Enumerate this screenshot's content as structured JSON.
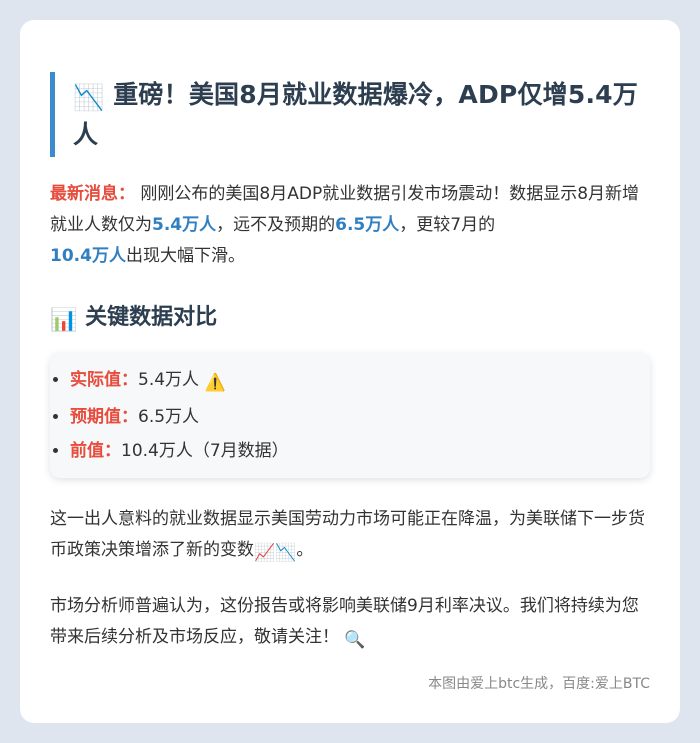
{
  "article": {
    "title": {
      "icon": "chart-decreasing-icon",
      "icon_glyph": "📉",
      "text": "重磅！美国8月就业数据爆冷，ADP仅增5.4万人"
    },
    "intro": {
      "label": "最新消息：",
      "t1": "刚刚公布的美国8月ADP就业数据引发市场震动！数据显示8月新增就业人数仅为",
      "actual": "5.4万人",
      "t2": "，远不及预期的",
      "expected": "6.5万人",
      "t3": "，更较7月的",
      "previous": "10.4万人",
      "t4": "出现大幅下滑。"
    },
    "section": {
      "icon": "bar-chart-icon",
      "icon_glyph": "📊",
      "text": "关键数据对比"
    },
    "comparison": [
      {
        "key": "实际值：",
        "value": "5.4万人",
        "icon": "warning-icon",
        "icon_glyph": "⚠️"
      },
      {
        "key": "预期值：",
        "value": "6.5万人"
      },
      {
        "key": "前值：",
        "value": "10.4万人（7月数据）"
      }
    ],
    "para2": {
      "text": "这一出人意料的就业数据显示美国劳动力市场可能正在降温，为美联储下一步货币政策决策增添了新的变数",
      "icon1": "chart-increasing-icon",
      "glyph1": "📈",
      "icon2": "chart-decreasing-icon",
      "glyph2": "📉",
      "end": "。"
    },
    "para3": {
      "text": "市场分析师普遍认为，这份报告或将影响美联储9月利率决议。我们将持续为您带来后续分析及市场反应，敬请关注！",
      "icon": "magnifier-icon",
      "glyph": "🔍"
    },
    "footer": "本图由爱上btc生成，百度:爱上BTC"
  },
  "colors": {
    "background": "#dfe5ef",
    "card": "#ffffff",
    "accent_blue": "#2f7fc1",
    "title_border": "#3b8ccf",
    "highlight_red": "#e74c3c",
    "heading": "#2c3e50"
  }
}
